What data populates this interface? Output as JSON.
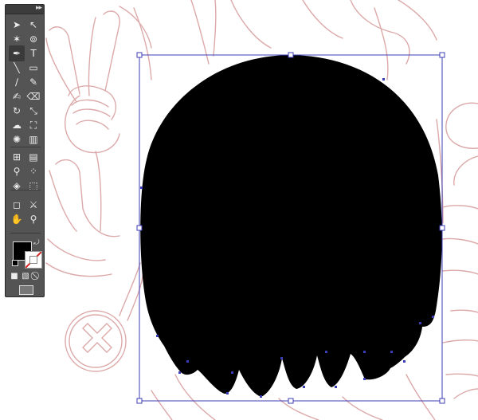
{
  "colors": {
    "sketch": "#d9a0a0",
    "selection": "#3c3cb4",
    "fill": "#000000",
    "stroke": "none",
    "toolbox_bg": "#545454"
  },
  "toolbox": {
    "collapse_label": "▸▸",
    "tools": [
      {
        "name": "selection-tool-icon",
        "glyph": "➤"
      },
      {
        "name": "direct-selection-tool-icon",
        "glyph": "↖"
      },
      {
        "name": "magic-wand-tool-icon",
        "glyph": "✶"
      },
      {
        "name": "lasso-tool-icon",
        "glyph": "⊚"
      },
      {
        "name": "pen-tool-icon",
        "glyph": "✒"
      },
      {
        "name": "type-tool-icon",
        "glyph": "T"
      },
      {
        "name": "line-segment-tool-icon",
        "glyph": "╲"
      },
      {
        "name": "rectangle-tool-icon",
        "glyph": "▭"
      },
      {
        "name": "paintbrush-tool-icon",
        "glyph": "∕"
      },
      {
        "name": "pencil-tool-icon",
        "glyph": "✎"
      },
      {
        "name": "blob-brush-tool-icon",
        "glyph": "✍"
      },
      {
        "name": "eraser-tool-icon",
        "glyph": "⌫"
      },
      {
        "name": "rotate-tool-icon",
        "glyph": "↻"
      },
      {
        "name": "scale-tool-icon",
        "glyph": "⤡"
      },
      {
        "name": "warp-tool-icon",
        "glyph": "☁"
      },
      {
        "name": "free-transform-tool-icon",
        "glyph": "⛶"
      },
      {
        "name": "symbol-sprayer-tool-icon",
        "glyph": "✺"
      },
      {
        "name": "column-graph-tool-icon",
        "glyph": "▥"
      },
      {
        "name": "mesh-tool-icon",
        "glyph": "⊞"
      },
      {
        "name": "gradient-tool-icon",
        "glyph": "▤"
      },
      {
        "name": "eyedropper-tool-icon",
        "glyph": "⚲"
      },
      {
        "name": "blend-tool-icon",
        "glyph": "⁘"
      },
      {
        "name": "live-paint-bucket-tool-icon",
        "glyph": "◈"
      },
      {
        "name": "live-paint-selection-tool-icon",
        "glyph": "⬚"
      },
      {
        "name": "artboard-tool-icon",
        "glyph": "◻"
      },
      {
        "name": "slice-tool-icon",
        "glyph": "⚔"
      },
      {
        "name": "hand-tool-icon",
        "glyph": "✋"
      },
      {
        "name": "zoom-tool-icon",
        "glyph": "⚲"
      }
    ],
    "mode_buttons": [
      {
        "name": "color-mode-icon",
        "glyph": "■"
      },
      {
        "name": "gradient-mode-icon",
        "glyph": "▧"
      },
      {
        "name": "none-mode-icon",
        "glyph": "⃠"
      }
    ],
    "screen_mode_glyph": "▭"
  }
}
